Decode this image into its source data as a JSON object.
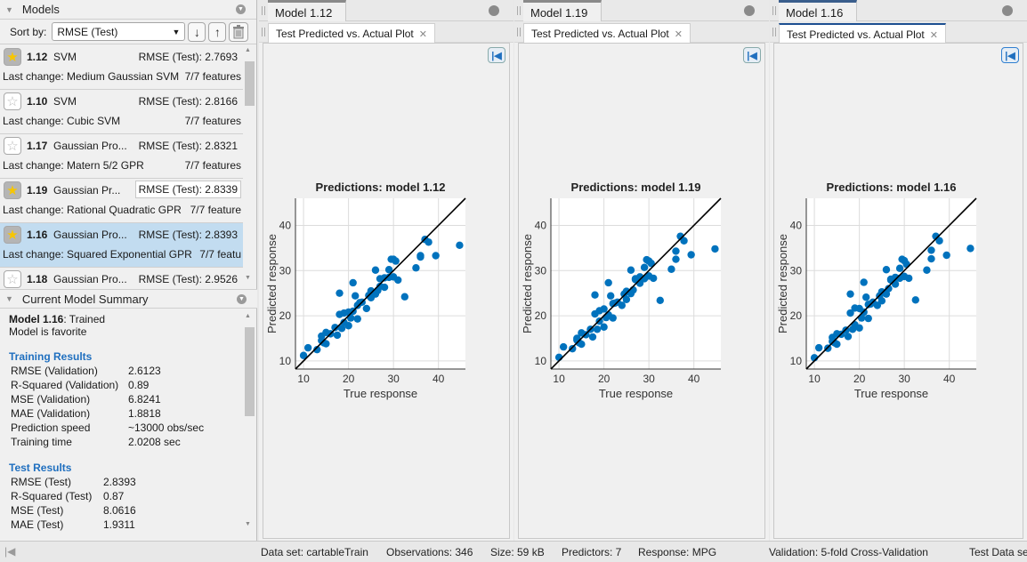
{
  "models_panel": {
    "title": "Models",
    "sort_label": "Sort by:",
    "sort_value": "RMSE (Test)",
    "items": [
      {
        "id": "1.12",
        "type": "SVM",
        "rmse": "RMSE (Test): 2.7693",
        "last_change": "Last change: Medium Gaussian SVM",
        "features": "7/7 features",
        "favorite": true,
        "selected": false,
        "highlight_rmse": false
      },
      {
        "id": "1.10",
        "type": "SVM",
        "rmse": "RMSE (Test): 2.8166",
        "last_change": "Last change: Cubic SVM",
        "features": "7/7 features",
        "favorite": false,
        "selected": false,
        "highlight_rmse": false
      },
      {
        "id": "1.17",
        "type": "Gaussian Pro...",
        "rmse": "RMSE (Test): 2.8321",
        "last_change": "Last change: Matern 5/2 GPR",
        "features": "7/7 features",
        "favorite": false,
        "selected": false,
        "highlight_rmse": false
      },
      {
        "id": "1.19",
        "type": "Gaussian Pr...",
        "rmse": "RMSE (Test): 2.8339",
        "last_change": "Last change: Rational Quadratic GPR",
        "features": "7/7 feature",
        "favorite": true,
        "selected": false,
        "highlight_rmse": true
      },
      {
        "id": "1.16",
        "type": "Gaussian Pro...",
        "rmse": "RMSE (Test): 2.8393",
        "last_change": "Last change: Squared Exponential GPR",
        "features": "7/7 featu",
        "favorite": true,
        "selected": true,
        "highlight_rmse": false
      },
      {
        "id": "1.18",
        "type": "Gaussian Pro...",
        "rmse": "RMSE (Test): 2.9526",
        "last_change": "",
        "features": "",
        "favorite": false,
        "selected": false,
        "highlight_rmse": false
      }
    ]
  },
  "summary": {
    "title": "Current Model Summary",
    "model_label": "Model 1.16",
    "model_state": ": Trained",
    "favorite_note": "Model is favorite",
    "training_title": "Training Results",
    "training": [
      {
        "k": "RMSE (Validation)",
        "v": "2.6123"
      },
      {
        "k": "R-Squared (Validation)",
        "v": "0.89"
      },
      {
        "k": "MSE (Validation)",
        "v": "6.8241"
      },
      {
        "k": "MAE (Validation)",
        "v": "1.8818"
      },
      {
        "k": "Prediction speed",
        "v": "~13000 obs/sec"
      },
      {
        "k": "Training time",
        "v": "2.0208 sec"
      }
    ],
    "test_title": "Test Results",
    "test": [
      {
        "k": "RMSE (Test)",
        "v": "2.8393"
      },
      {
        "k": "R-Squared (Test)",
        "v": "0.87"
      },
      {
        "k": "MSE (Test)",
        "v": "8.0616"
      },
      {
        "k": "MAE (Test)",
        "v": "1.9311"
      }
    ]
  },
  "documents": [
    {
      "tab": "Model 1.12",
      "plot_tab": "Test Predicted vs. Actual Plot",
      "active": false
    },
    {
      "tab": "Model 1.19",
      "plot_tab": "Test Predicted vs. Actual Plot",
      "active": false
    },
    {
      "tab": "Model 1.16",
      "plot_tab": "Test Predicted vs. Actual Plot",
      "active": true
    }
  ],
  "status_bar": {
    "dataset": "Data set: cartableTrain",
    "observations": "Observations: 346",
    "size": "Size: 59 kB",
    "predictors": "Predictors: 7",
    "response": "Response: MPG",
    "validation": "Validation: 5-fold Cross-Validation",
    "test_data": "Test Data se"
  },
  "colors": {
    "accent": "#1f6fbf",
    "point": "#0072bd",
    "selected_row": "#c2dcf0",
    "star": "#f7c600"
  },
  "chart_data": [
    {
      "type": "scatter",
      "title": "Predictions: model 1.12",
      "xlabel": "True response",
      "ylabel": "Predicted response",
      "xlim": [
        8.2,
        46
      ],
      "ylim": [
        8.2,
        46
      ],
      "xticks": [
        10,
        20,
        30,
        40
      ],
      "yticks": [
        10,
        20,
        30,
        40
      ],
      "grid": true,
      "reference_line": "y = x",
      "x": [
        10,
        11,
        13,
        14,
        14.5,
        15,
        15,
        14,
        16,
        17,
        17.5,
        18,
        18,
        18.5,
        19,
        19,
        20,
        20,
        20.5,
        21,
        21,
        21.5,
        22,
        22,
        22.5,
        23,
        24,
        24.5,
        25,
        25,
        26,
        26,
        26.5,
        27,
        27,
        28,
        28,
        29,
        29,
        29.5,
        30,
        30,
        30.5,
        31,
        32.5,
        35,
        36,
        36,
        37,
        37.8,
        39.4,
        44.7
      ],
      "y": [
        11.2,
        12.9,
        12.5,
        15.5,
        14,
        13.8,
        16.3,
        14.5,
        16,
        17.4,
        15.7,
        20.3,
        25,
        17.2,
        18.5,
        20.6,
        17.8,
        20.8,
        19.5,
        27.3,
        21,
        24.4,
        22.3,
        19.3,
        22.9,
        23,
        21.6,
        24.5,
        25.5,
        24,
        30.1,
        24.8,
        25.6,
        28.2,
        26.5,
        28.4,
        26.3,
        30.2,
        28.5,
        32.5,
        32.5,
        28.6,
        32.1,
        27.9,
        24.2,
        30.6,
        33,
        33.3,
        36.9,
        36.3,
        33.3,
        35.6
      ]
    },
    {
      "type": "scatter",
      "title": "Predictions: model 1.19",
      "xlabel": "True response",
      "ylabel": "Predicted response",
      "xlim": [
        8.2,
        46
      ],
      "ylim": [
        8.2,
        46
      ],
      "xticks": [
        10,
        20,
        30,
        40
      ],
      "yticks": [
        10,
        20,
        30,
        40
      ],
      "grid": true,
      "reference_line": "y = x",
      "x": [
        10,
        11,
        13,
        14,
        14.5,
        15,
        15,
        14,
        16,
        17,
        17.5,
        18,
        18,
        18.5,
        19,
        19,
        20,
        20,
        20.5,
        21,
        21,
        21.5,
        22,
        22,
        22.5,
        23,
        24,
        24.5,
        25,
        25,
        26,
        26,
        26.5,
        27,
        27,
        28,
        28,
        29,
        29,
        29.5,
        30,
        30,
        30.5,
        31,
        32.5,
        35,
        36,
        36,
        37,
        37.8,
        39.4,
        44.7
      ],
      "y": [
        10.8,
        13.1,
        12.7,
        15,
        14,
        13.7,
        16.2,
        14.6,
        15.8,
        17,
        15.3,
        20.4,
        24.6,
        17,
        18.8,
        21.1,
        17.5,
        21.5,
        19.6,
        27.3,
        20.2,
        24.4,
        22.7,
        19.5,
        22.8,
        23,
        22.3,
        24.8,
        25.4,
        23.6,
        30.1,
        24.9,
        25.7,
        28.2,
        28,
        28.6,
        27.2,
        30.7,
        28.2,
        32.4,
        32.1,
        28.8,
        31.6,
        28.3,
        23.4,
        30.3,
        32.5,
        34.3,
        37.6,
        36.6,
        33.5,
        34.8
      ]
    },
    {
      "type": "scatter",
      "title": "Predictions: model 1.16",
      "xlabel": "True response",
      "ylabel": "Predicted response",
      "xlim": [
        8.2,
        46
      ],
      "ylim": [
        8.2,
        46
      ],
      "xticks": [
        10,
        20,
        30,
        40
      ],
      "yticks": [
        10,
        20,
        30,
        40
      ],
      "grid": true,
      "reference_line": "y = x",
      "x": [
        10,
        11,
        13,
        14,
        14.5,
        15,
        15,
        14,
        16,
        17,
        17.5,
        18,
        18,
        18.5,
        19,
        19,
        20,
        20,
        20.5,
        21,
        21,
        21.5,
        22,
        22,
        22.5,
        23,
        24,
        24.5,
        25,
        25,
        26,
        26,
        26.5,
        27,
        27,
        28,
        28,
        29,
        29,
        29.5,
        30,
        30,
        30.5,
        31,
        32.5,
        35,
        36,
        36,
        37,
        37.8,
        39.4,
        44.7
      ],
      "y": [
        10.7,
        12.9,
        12.8,
        15.2,
        14,
        13.7,
        16,
        14.3,
        15.9,
        16.8,
        15.4,
        20.6,
        24.8,
        17,
        18,
        21.7,
        17.3,
        21.6,
        19.5,
        27.4,
        20.8,
        24.1,
        22.5,
        19.4,
        22.6,
        23,
        22.3,
        24.4,
        25.3,
        23.3,
        30.2,
        24.8,
        26,
        28.1,
        27.9,
        28.5,
        27,
        30.5,
        28.3,
        32.5,
        32.2,
        28.7,
        31.4,
        28.3,
        23.5,
        30.1,
        32.6,
        34.5,
        37.6,
        36.6,
        33.4,
        34.9
      ]
    }
  ]
}
